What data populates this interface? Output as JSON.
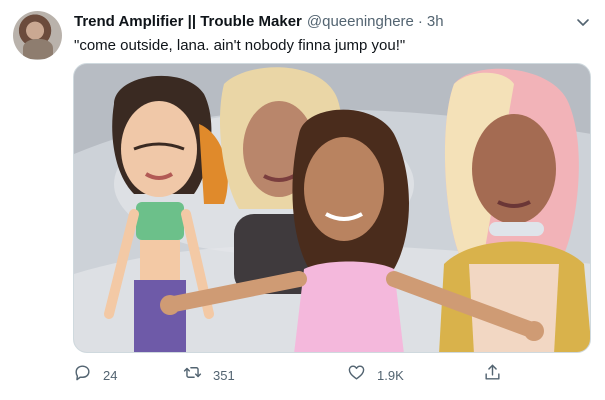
{
  "tweet": {
    "author": {
      "display_name": "Trend Amplifier || Trouble Maker",
      "handle": "@queeninghere",
      "separator": "·",
      "timestamp": "3h"
    },
    "text": "\"come outside, lana. ain't nobody finna jump you!\"",
    "media": {
      "kind": "meme-image",
      "description_icons": [
        "four-women-cartoon-bodies"
      ]
    },
    "actions": {
      "reply": {
        "icon": "reply-icon",
        "count": "24"
      },
      "retweet": {
        "icon": "retweet-icon",
        "count": "351"
      },
      "like": {
        "icon": "heart-icon",
        "count": "1.9K"
      },
      "share": {
        "icon": "share-icon"
      }
    },
    "menu_icon": "chevron-down-icon"
  },
  "colors": {
    "text_primary": "#0f1419",
    "text_secondary": "#536471",
    "border": "#cfd9de"
  }
}
